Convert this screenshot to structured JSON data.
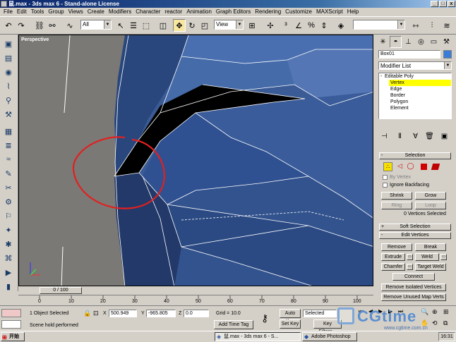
{
  "window": {
    "title": "鼠.max - 3ds max 6 - Stand-alone License",
    "min": "_",
    "max": "□",
    "close": "x"
  },
  "menu": [
    "File",
    "Edit",
    "Tools",
    "Group",
    "Views",
    "Create",
    "Modifiers",
    "Character",
    "reactor",
    "Animation",
    "Graph Editors",
    "Rendering",
    "Customize",
    "MAXScript",
    "Help"
  ],
  "toolbar": {
    "selection_filter": "All",
    "ref_coord": "View"
  },
  "viewport": {
    "label": "Perspective"
  },
  "timeline": {
    "frame": "0 / 100",
    "ticks": [
      "0",
      "10",
      "20",
      "30",
      "40",
      "50",
      "60",
      "70",
      "80",
      "90",
      "100"
    ]
  },
  "panel": {
    "object_name": "Box01",
    "object_color": "#3a7dd8",
    "modifier_list": "Modifier List",
    "stack": [
      "Editable Poly",
      "Vertex",
      "Edge",
      "Border",
      "Polygon",
      "Element"
    ],
    "selection": {
      "title": "Selection",
      "by_vertex": "By Vertex",
      "ignore_backfacing": "Ignore Backfacing",
      "shrink": "Shrink",
      "grow": "Grow",
      "ring": "Ring",
      "loop": "Loop",
      "status": "0 Vertices Selected"
    },
    "soft_selection": "Soft Selection",
    "edit_vertices": {
      "title": "Edit Vertices",
      "remove": "Remove",
      "break": "Break",
      "extrude": "Extrude",
      "weld": "Weld",
      "chamfer": "Chamfer",
      "target_weld": "Target Weld",
      "connect": "Connect",
      "remove_isolated": "Remove Isolated Vertices",
      "remove_unused": "Remove Unused Map Verts"
    },
    "plus": "+",
    "minus": "-"
  },
  "status": {
    "selected": "1 Object Selected",
    "prompt": "Scene hold performed",
    "x_label": "X",
    "x": "500.949",
    "y_label": "Y",
    "y": "-965.805",
    "z_label": "Z",
    "z": "0.0",
    "grid": "Grid = 10.0",
    "add_time_tag": "Add Time Tag",
    "auto_key": "Auto Key",
    "set_key": "Set Key",
    "key_mode": "Selected",
    "key_filters": "Key Filters..."
  },
  "taskbar": {
    "start": "开始",
    "tasks": [
      "鼠.max - 3ds max 6 - S...",
      "Adobe Photoshop"
    ],
    "time": "16:31"
  },
  "watermark": {
    "brand": "CGtime",
    "url": "www.cgtime.com.cn"
  }
}
